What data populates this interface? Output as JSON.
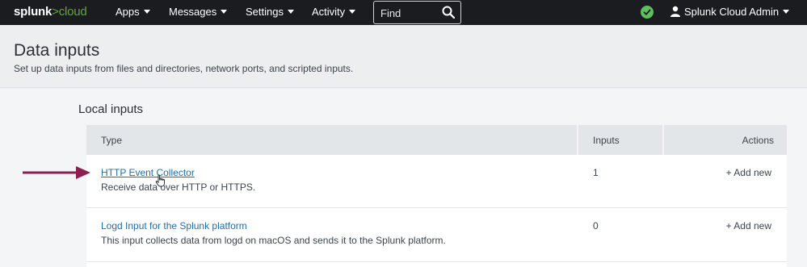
{
  "topbar": {
    "logo_main": "splunk",
    "logo_sep": ">",
    "logo_sub": "cloud",
    "nav": [
      {
        "label": "Apps"
      },
      {
        "label": "Messages"
      },
      {
        "label": "Settings"
      },
      {
        "label": "Activity"
      }
    ],
    "search_placeholder": "Find",
    "user_label": "Splunk Cloud Admin"
  },
  "header": {
    "title": "Data inputs",
    "subtitle": "Set up data inputs from files and directories, network ports, and scripted inputs."
  },
  "section": {
    "title": "Local inputs"
  },
  "table": {
    "columns": [
      "Type",
      "Inputs",
      "Actions"
    ],
    "rows": [
      {
        "name": "HTTP Event Collector",
        "description": "Receive data over HTTP or HTTPS.",
        "inputs": "1",
        "action": "+ Add new"
      },
      {
        "name": "Logd Input for the Splunk platform",
        "description": "This input collects data from logd on macOS and sends it to the Splunk platform.",
        "inputs": "0",
        "action": "+ Add new"
      }
    ]
  },
  "colors": {
    "topbar_bg": "#1a1c20",
    "brand_green": "#65a637",
    "status_ok": "#5cc05c",
    "link": "#1e6fa8",
    "arrow": "#8c1f4f"
  }
}
